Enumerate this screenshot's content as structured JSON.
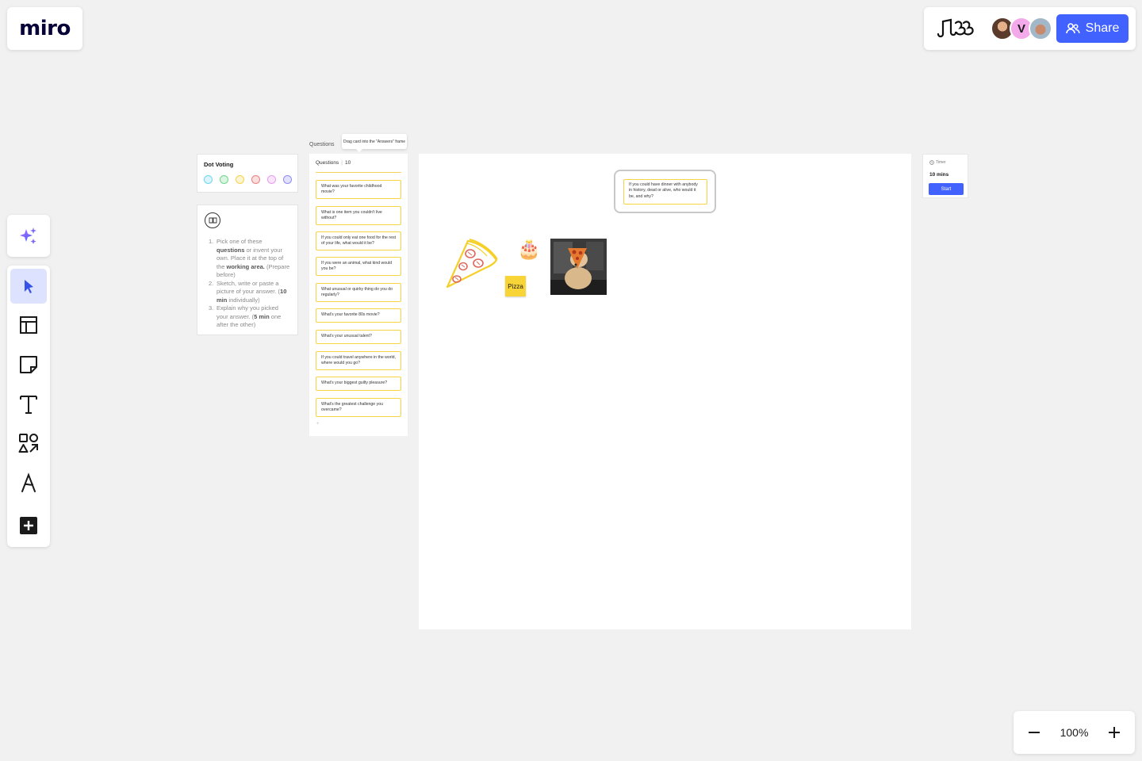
{
  "app": {
    "logo": "miro",
    "board_icon": "board-scribble-icon",
    "share_label": "Share",
    "avatars": [
      {
        "initial": "",
        "color": "#5a3a2a"
      },
      {
        "initial": "V",
        "color": "#f4a9ea"
      },
      {
        "initial": "",
        "color": "#a2b7c7"
      }
    ],
    "accent_color": "#4262ff"
  },
  "toolbar": {
    "ai_tool": "sparkles-icon",
    "tools": [
      "select-cursor-icon",
      "templates-icon",
      "sticky-note-icon",
      "text-icon",
      "shapes-icon",
      "pen-icon",
      "add-more-icon"
    ],
    "active": "select-cursor-icon"
  },
  "zoom": {
    "level": "100%"
  },
  "dot_voting": {
    "title": "Dot Voting",
    "dot_colors": [
      "#6dd6f0",
      "#6fd78c",
      "#f6d34a",
      "#f08080",
      "#e69bf0",
      "#8f8cf5"
    ]
  },
  "instructions": {
    "items": [
      {
        "num": "1.",
        "parts": [
          "Pick one of these ",
          "questions",
          " or invent your own. Place it at the top of the ",
          "working area.",
          " (Prepare before)"
        ]
      },
      {
        "num": "2.",
        "parts": [
          "Sketch, write or paste a picture of your answer. (",
          "10 min",
          " individually)"
        ]
      },
      {
        "num": "3.",
        "parts": [
          "Explain why you picked your answer. (",
          "5 min",
          " one after the other)"
        ]
      }
    ]
  },
  "questions_frame": {
    "frame_label": "Questions",
    "tooltip": "Drag card into the \"Answers\" frame",
    "header": "Questions",
    "count": "10",
    "cards": [
      "What was your favorite childhood movie?",
      "What is one item you couldn't live without?",
      "If you could only eat one food for the rest of your life, what would it be?",
      "If you were an animal, what kind would you be?",
      "What unusual or quirky thing do you do regularly?",
      "What's your favorite 80s movie?",
      "What's your unusual talent?",
      "If you could travel anywhere in the world, where would you go?",
      "What's your biggest guilty pleasure?",
      "What's the greatest challenge you overcame?"
    ],
    "add": "+"
  },
  "answers": {
    "question": "If you could have dinner with anybody in history, dead or alive, who would it be, and why?",
    "sticky": "Pizza",
    "cake_emoji": "🎂"
  },
  "timer": {
    "label": "Timer",
    "value": "10 mins",
    "button": "Start"
  }
}
